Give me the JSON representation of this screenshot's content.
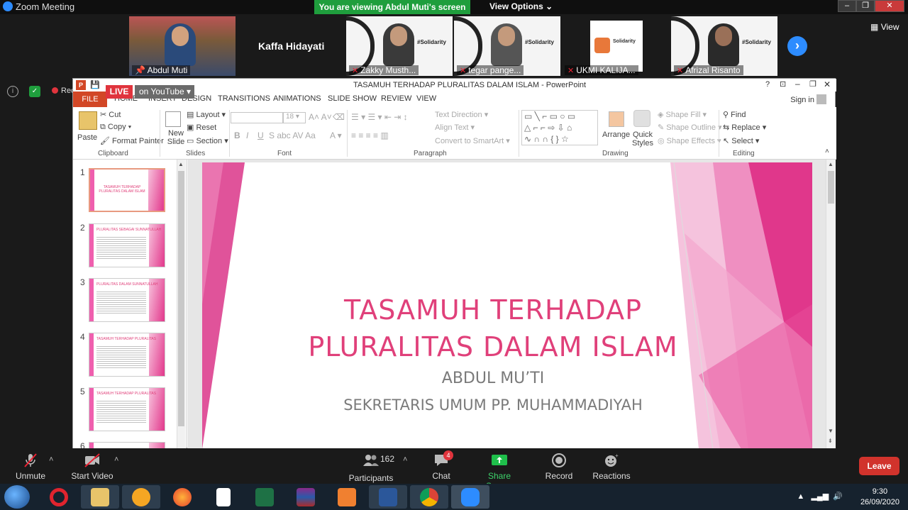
{
  "zoom": {
    "window_title": "Zoom Meeting",
    "viewing_banner": "You are viewing Abdul Muti's screen",
    "view_options": "View Options",
    "view_button": "View",
    "recording_label": "Recording",
    "live_label": "LIVE",
    "youtube_label": "on YouTube",
    "participants_strip": [
      {
        "name": "Abdul Muti"
      },
      {
        "name": "Kaffa Hidayati"
      },
      {
        "name": "Zakky Musth..."
      },
      {
        "name": "tegar pange..."
      },
      {
        "name": "UKMI KALIJA..."
      },
      {
        "name": "Afrizal Risanto"
      }
    ],
    "toolbar": {
      "unmute": "Unmute",
      "start_video": "Start Video",
      "participants": "Participants",
      "participants_count": "162",
      "chat": "Chat",
      "chat_badge": "4",
      "share_screen": "Share Screen",
      "record": "Record",
      "reactions": "Reactions",
      "leave": "Leave"
    }
  },
  "powerpoint": {
    "title": "TASAMUH TERHADAP PLURALITAS DALAM ISLAM - PowerPoint",
    "sign_in": "Sign in",
    "tabs": [
      "FILE",
      "HOME",
      "INSERT",
      "DESIGN",
      "TRANSITIONS",
      "ANIMATIONS",
      "SLIDE SHOW",
      "REVIEW",
      "VIEW"
    ],
    "ribbon": {
      "clipboard": {
        "paste": "Paste",
        "cut": "Cut",
        "copy": "Copy",
        "format_painter": "Format Painter",
        "label": "Clipboard"
      },
      "slides": {
        "new_slide": "New Slide",
        "layout": "Layout",
        "reset": "Reset",
        "section": "Section",
        "label": "Slides"
      },
      "font": {
        "size": "18",
        "label": "Font"
      },
      "paragraph": {
        "text_direction": "Text Direction",
        "align_text": "Align Text",
        "convert_smartart": "Convert to SmartArt",
        "label": "Paragraph"
      },
      "drawing": {
        "arrange": "Arrange",
        "quick_styles": "Quick Styles",
        "shape_fill": "Shape Fill",
        "shape_outline": "Shape Outline",
        "shape_effects": "Shape Effects",
        "label": "Drawing"
      },
      "editing": {
        "find": "Find",
        "replace": "Replace",
        "select": "Select",
        "label": "Editing"
      }
    },
    "thumbnails": [
      {
        "num": "1",
        "title": "TASAMUH TERHADAP PLURALITAS DALAM ISLAM"
      },
      {
        "num": "2",
        "title": "PLURALITAS SEBAGAI SUNNATULLAH"
      },
      {
        "num": "3",
        "title": "PLURALITAS DALAM SUNNATULLAH"
      },
      {
        "num": "4",
        "title": "TASAMUH TERHADAP PLURALITAS"
      },
      {
        "num": "5",
        "title": "TASAMUH TERHADAP PLURALITAS"
      },
      {
        "num": "6",
        "title": ""
      }
    ],
    "slide": {
      "title_line1": "TASAMUH TERHADAP",
      "title_line2": "PLURALITAS DALAM ISLAM",
      "subtitle_line1": "ABDUL MU’TI",
      "subtitle_line2": "SEKRETARIS UMUM PP. MUHAMMADIYAH"
    }
  },
  "taskbar": {
    "time": "9:30",
    "date": "26/09/2020"
  },
  "colors": {
    "slide_pink": "#e0407a",
    "zoom_green": "#1f9e3d",
    "zoom_blue": "#2d8cff",
    "leave_red": "#d1332c",
    "ppt_file_tab": "#d24726"
  }
}
